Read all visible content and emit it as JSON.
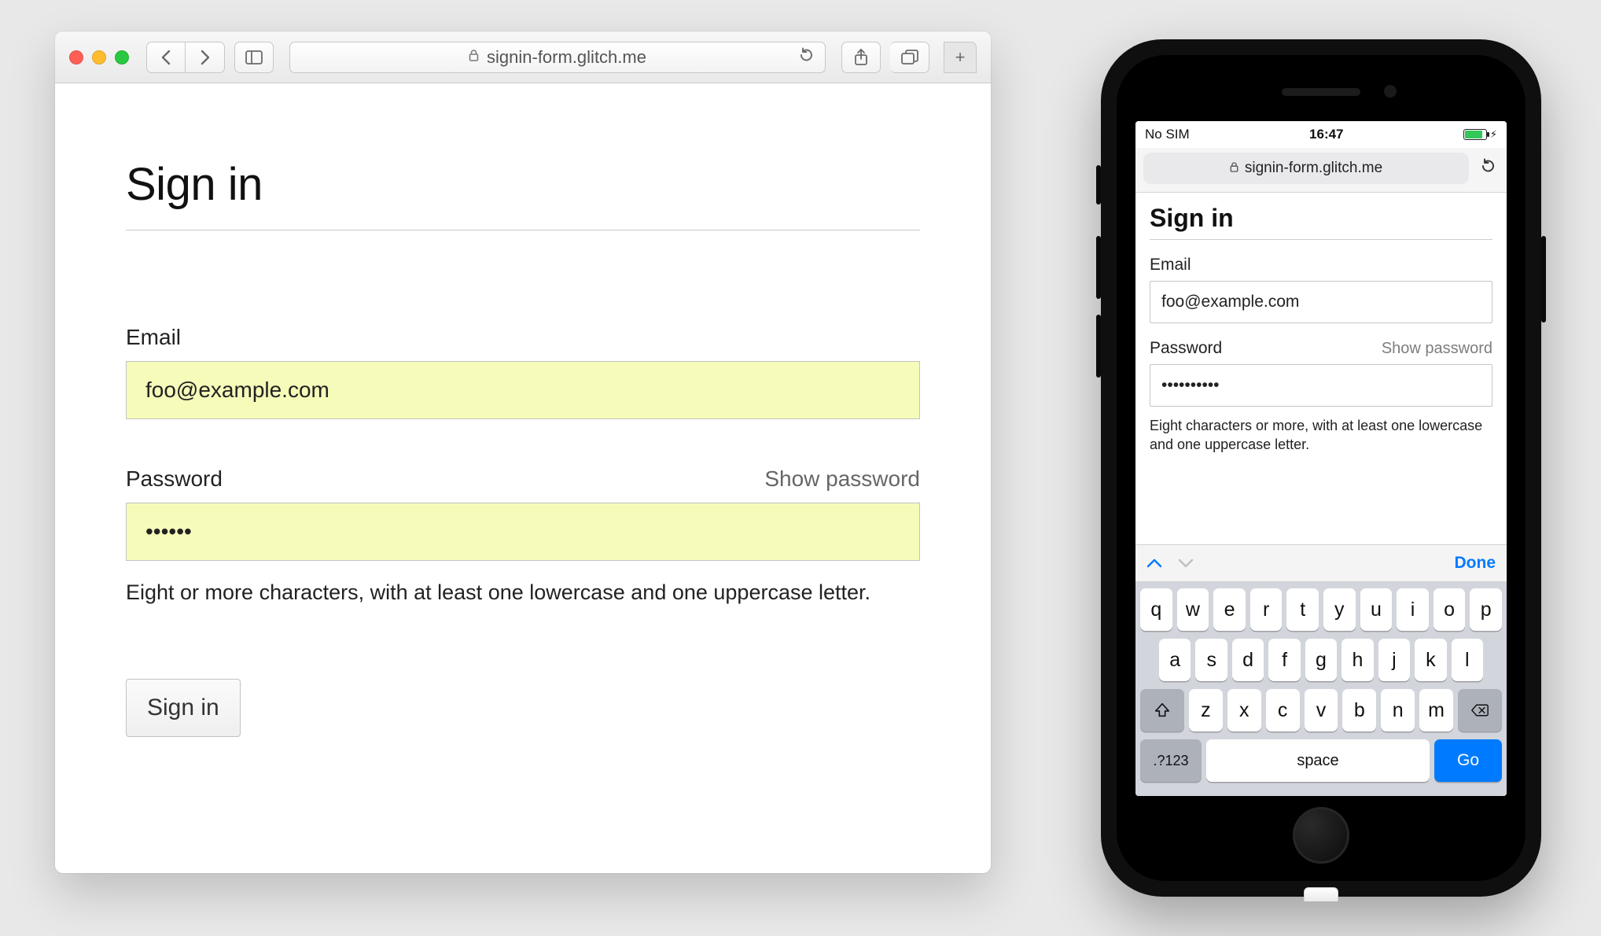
{
  "desktop": {
    "url": "signin-form.glitch.me",
    "page": {
      "title": "Sign in",
      "email_label": "Email",
      "email_value": "foo@example.com",
      "password_label": "Password",
      "show_password": "Show password",
      "password_value": "••••••",
      "password_hint": "Eight or more characters, with at least one lowercase and one uppercase letter.",
      "submit_label": "Sign in"
    }
  },
  "mobile": {
    "status": {
      "carrier": "No SIM",
      "time": "16:47"
    },
    "url": "signin-form.glitch.me",
    "page": {
      "title": "Sign in",
      "email_label": "Email",
      "email_value": "foo@example.com",
      "password_label": "Password",
      "show_password": "Show password",
      "password_value": "••••••••••",
      "password_hint": "Eight characters or more, with at least one lowercase and one uppercase letter."
    },
    "keyboard": {
      "done": "Done",
      "rows": {
        "r1": [
          "q",
          "w",
          "e",
          "r",
          "t",
          "y",
          "u",
          "i",
          "o",
          "p"
        ],
        "r2": [
          "a",
          "s",
          "d",
          "f",
          "g",
          "h",
          "j",
          "k",
          "l"
        ],
        "r3": [
          "z",
          "x",
          "c",
          "v",
          "b",
          "n",
          "m"
        ]
      },
      "num_switch": ".?123",
      "space": "space",
      "go": "Go"
    }
  }
}
